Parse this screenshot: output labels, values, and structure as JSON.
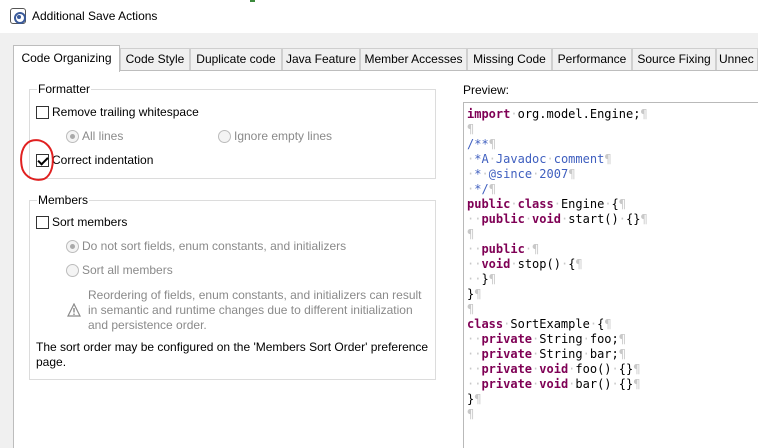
{
  "window": {
    "title": "Additional Save Actions"
  },
  "tabs": [
    {
      "label": "Code Organizing",
      "active": true
    },
    {
      "label": "Code Style"
    },
    {
      "label": "Duplicate code"
    },
    {
      "label": "Java Feature"
    },
    {
      "label": "Member Accesses"
    },
    {
      "label": "Missing Code"
    },
    {
      "label": "Performance"
    },
    {
      "label": "Source Fixing"
    },
    {
      "label": "Unnec"
    }
  ],
  "formatter": {
    "title": "Formatter",
    "remove_trailing_whitespace": {
      "label": "Remove trailing whitespace",
      "checked": false
    },
    "all_lines": {
      "label": "All lines",
      "selected": true,
      "enabled": false
    },
    "ignore_empty_lines": {
      "label": "Ignore empty lines",
      "selected": false,
      "enabled": false
    },
    "correct_indentation": {
      "label": "Correct indentation",
      "checked": true
    }
  },
  "members": {
    "title": "Members",
    "sort_members": {
      "label": "Sort members",
      "checked": false
    },
    "do_not_sort": {
      "label": "Do not sort fields, enum constants, and initializers",
      "selected": true,
      "enabled": false
    },
    "sort_all": {
      "label": "Sort all members",
      "selected": false,
      "enabled": false
    },
    "warning": "Reordering of fields, enum constants, and initializers can result in semantic and runtime changes due to different initialization and persistence order.",
    "warning_icon": "warning-icon",
    "note": "The sort order may be configured on the 'Members Sort Order' preference page."
  },
  "preview": {
    "label": "Preview:",
    "lines": [
      [
        [
          "kw",
          "import"
        ],
        [
          "ws",
          "·"
        ],
        [
          "t",
          "org.model.Engine;"
        ],
        [
          "ws",
          "¶"
        ]
      ],
      [
        [
          "ws",
          "¶"
        ]
      ],
      [
        [
          "cm",
          "/**"
        ],
        [
          "ws",
          "¶"
        ]
      ],
      [
        [
          "ws",
          "·"
        ],
        [
          "cm",
          "*A"
        ],
        [
          "ws",
          "·"
        ],
        [
          "cm",
          "Javadoc"
        ],
        [
          "ws",
          "·"
        ],
        [
          "cm",
          "comment"
        ],
        [
          "ws",
          "¶"
        ]
      ],
      [
        [
          "ws",
          "·"
        ],
        [
          "cm",
          "*"
        ],
        [
          "ws",
          "·"
        ],
        [
          "cm",
          "@since"
        ],
        [
          "ws",
          "·"
        ],
        [
          "cm",
          "2007"
        ],
        [
          "ws",
          "¶"
        ]
      ],
      [
        [
          "ws",
          "·"
        ],
        [
          "cm",
          "*/"
        ],
        [
          "ws",
          "¶"
        ]
      ],
      [
        [
          "kw",
          "public"
        ],
        [
          "ws",
          "·"
        ],
        [
          "kw",
          "class"
        ],
        [
          "ws",
          "·"
        ],
        [
          "t",
          "Engine"
        ],
        [
          "ws",
          "·"
        ],
        [
          "t",
          "{"
        ],
        [
          "ws",
          "¶"
        ]
      ],
      [
        [
          "ws",
          "··"
        ],
        [
          "kw",
          "public"
        ],
        [
          "ws",
          "·"
        ],
        [
          "kw",
          "void"
        ],
        [
          "ws",
          "·"
        ],
        [
          "t",
          "start()"
        ],
        [
          "ws",
          "·"
        ],
        [
          "t",
          "{}"
        ],
        [
          "ws",
          "¶"
        ]
      ],
      [
        [
          "ws",
          "¶"
        ]
      ],
      [
        [
          "ws",
          "··"
        ],
        [
          "kw",
          "public"
        ],
        [
          "ws",
          "·¶"
        ]
      ],
      [
        [
          "ws",
          "··"
        ],
        [
          "kw",
          "void"
        ],
        [
          "ws",
          "·"
        ],
        [
          "t",
          "stop()"
        ],
        [
          "ws",
          "·"
        ],
        [
          "t",
          "{"
        ],
        [
          "ws",
          "¶"
        ]
      ],
      [
        [
          "ws",
          "··"
        ],
        [
          "t",
          "}"
        ],
        [
          "ws",
          "¶"
        ]
      ],
      [
        [
          "t",
          "}"
        ],
        [
          "ws",
          "¶"
        ]
      ],
      [
        [
          "ws",
          "¶"
        ]
      ],
      [
        [
          "kw",
          "class"
        ],
        [
          "ws",
          "·"
        ],
        [
          "t",
          "SortExample"
        ],
        [
          "ws",
          "·"
        ],
        [
          "t",
          "{"
        ],
        [
          "ws",
          "¶"
        ]
      ],
      [
        [
          "ws",
          "··"
        ],
        [
          "kw",
          "private"
        ],
        [
          "ws",
          "·"
        ],
        [
          "t",
          "String"
        ],
        [
          "ws",
          "·"
        ],
        [
          "t",
          "foo;"
        ],
        [
          "ws",
          "¶"
        ]
      ],
      [
        [
          "ws",
          "··"
        ],
        [
          "kw",
          "private"
        ],
        [
          "ws",
          "·"
        ],
        [
          "t",
          "String"
        ],
        [
          "ws",
          "·"
        ],
        [
          "t",
          "bar;"
        ],
        [
          "ws",
          "¶"
        ]
      ],
      [
        [
          "ws",
          "··"
        ],
        [
          "kw",
          "private"
        ],
        [
          "ws",
          "·"
        ],
        [
          "kw",
          "void"
        ],
        [
          "ws",
          "·"
        ],
        [
          "t",
          "foo()"
        ],
        [
          "ws",
          "·"
        ],
        [
          "t",
          "{}"
        ],
        [
          "ws",
          "¶"
        ]
      ],
      [
        [
          "ws",
          "··"
        ],
        [
          "kw",
          "private"
        ],
        [
          "ws",
          "·"
        ],
        [
          "kw",
          "void"
        ],
        [
          "ws",
          "·"
        ],
        [
          "t",
          "bar()"
        ],
        [
          "ws",
          "·"
        ],
        [
          "t",
          "{}"
        ],
        [
          "ws",
          "¶"
        ]
      ],
      [
        [
          "t",
          "}"
        ],
        [
          "ws",
          "¶"
        ]
      ],
      [
        [
          "ws",
          "¶"
        ]
      ]
    ]
  },
  "colors": {
    "keyword": "#7f0055",
    "comment": "#3f5fbf",
    "whitespace_marker": "#c8c8c8",
    "annotation": "#e02020"
  }
}
